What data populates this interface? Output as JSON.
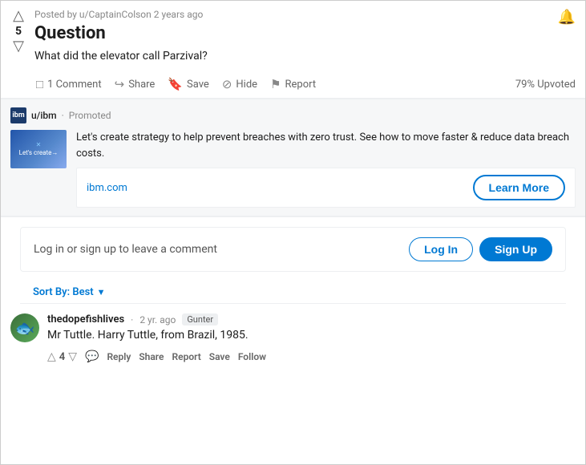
{
  "post": {
    "meta": "Posted by u/CaptainColson  2 years ago",
    "vote_count": "5",
    "title": "Question",
    "body": "What did the elevator call Parzival?",
    "upvoted_stat": "79% Upvoted"
  },
  "actions": {
    "comment_label": "1 Comment",
    "share_label": "Share",
    "save_label": "Save",
    "hide_label": "Hide",
    "report_label": "Report"
  },
  "ad": {
    "username": "u/ibm",
    "promoted_label": "Promoted",
    "description": "Let's create strategy to help prevent breaches with zero trust. See how to move faster & reduce data breach costs.",
    "url": "ibm.com",
    "learn_more_label": "Learn More",
    "thumbnail_text": "Let's create→"
  },
  "login_section": {
    "prompt_text": "Log in or sign up to leave a comment",
    "log_in_label": "Log In",
    "sign_up_label": "Sign Up"
  },
  "sort": {
    "label": "Sort By: Best",
    "arrow": "▼"
  },
  "comments": [
    {
      "username": "thedopefishlives",
      "time": "2 yr. ago",
      "flair": "Gunter",
      "text": "Mr Tuttle. Harry Tuttle, from Brazil, 1985.",
      "vote_count": "4",
      "reply_label": "Reply",
      "share_label": "Share",
      "report_label": "Report",
      "save_label": "Save",
      "follow_label": "Follow"
    }
  ],
  "icons": {
    "upvote": "△",
    "downvote": "▽",
    "notification": "🔔",
    "comment": "💬",
    "share": "↪",
    "save": "🔖",
    "hide": "👁",
    "report": "⚑",
    "reply": "💬"
  }
}
